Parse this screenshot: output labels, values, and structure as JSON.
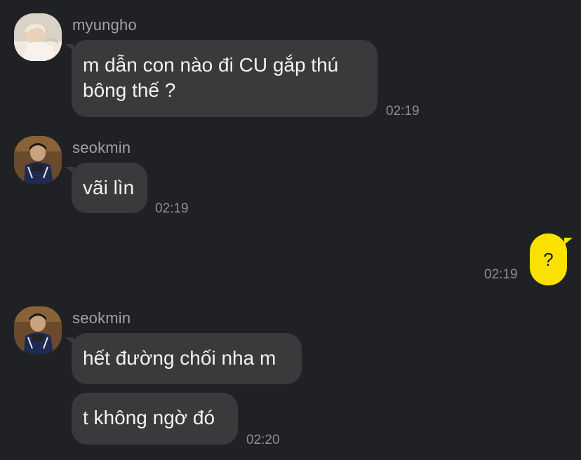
{
  "messages": [
    {
      "sender": "myungho",
      "text_line1": "m dẫn con nào đi CU gắp thú",
      "text_line2": "bông thế ?",
      "time": "02:19"
    },
    {
      "sender": "seokmin",
      "text": "vãi lìn",
      "time": "02:19"
    },
    {
      "sender": "me",
      "text": "?",
      "time": "02:19"
    },
    {
      "sender": "seokmin",
      "text1": "hết đường chối nha m",
      "text2": "t không ngờ đó",
      "time": "02:20"
    }
  ],
  "colors": {
    "background": "#202124",
    "bubble_other": "#3a3a3c",
    "bubble_me": "#fae100",
    "text_muted": "#8e8e93"
  }
}
